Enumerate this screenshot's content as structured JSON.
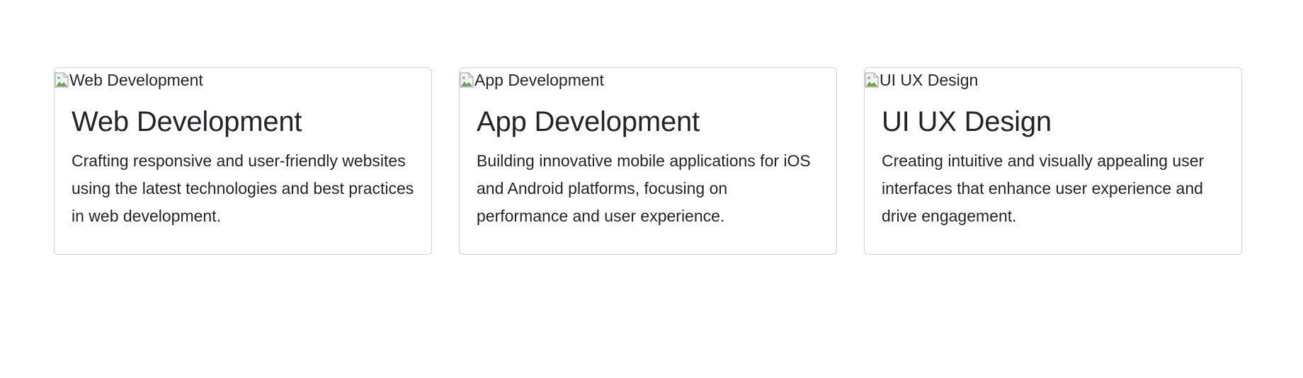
{
  "cards": [
    {
      "img_alt": "Web Development",
      "title": "Web Development",
      "text": "Crafting responsive and user-friendly websites using the latest technologies and best practices in web development."
    },
    {
      "img_alt": "App Development",
      "title": "App Development",
      "text": "Building innovative mobile applications for iOS and Android platforms, focusing on performance and user experience."
    },
    {
      "img_alt": "UI UX Design",
      "title": "UI UX Design",
      "text": "Creating intuitive and visually appealing user interfaces that enhance user experience and drive engagement."
    }
  ],
  "icons": {
    "broken_image": "broken-image-icon"
  }
}
